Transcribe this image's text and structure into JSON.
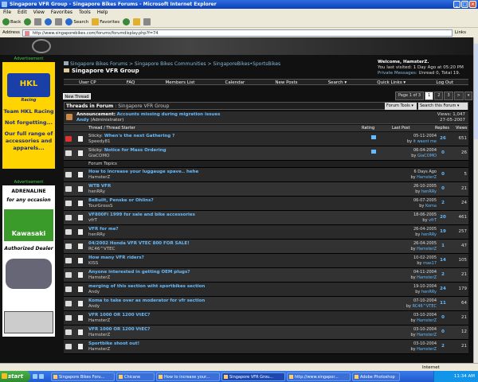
{
  "window": {
    "title": "Singapore VFR Group - Singapore Bikes Forums - Microsoft Internet Explorer"
  },
  "menu": [
    "File",
    "Edit",
    "View",
    "Favorites",
    "Tools",
    "Help"
  ],
  "toolbar": {
    "back": "Back",
    "search": "Search",
    "favorites": "Favorites"
  },
  "address": {
    "label": "Address",
    "url": "http://www.singaporebikes.com/forums/forumdisplay.php?f=74",
    "links": "Links"
  },
  "sidebar": {
    "ad_label_1": "Advertisement",
    "ad1_brand": "HKL",
    "ad1_sub": "Racing",
    "ad1_line1": "Team HKL Racing",
    "ad1_line2": "Not forgetting...",
    "ad1_line3": "Our full range of",
    "ad1_line4": "accessories and",
    "ad1_line5": "apparels...",
    "ad_label_2": "Advertisement",
    "ad2_line1": "ADRENALINE",
    "ad2_line2": "for any occasion",
    "ad2_brand": "Kawasaki",
    "ad2_line3": "Authorized Dealer"
  },
  "breadcrumb": "Singapore Bikes Forums > Singapore Bikes Communities > SingaporeBikes•SportsBikes",
  "page_title": "Singapore VFR Group",
  "welcome": {
    "greeting": "Welcome, HamsterZ.",
    "last_visit": "You last visited: 1 Day Ago at 05:20 PM",
    "pm_label": "Private Messages:",
    "pm_value": "Unread 0, Total 19."
  },
  "nav": [
    "User CP",
    "FAQ",
    "Members List",
    "Calendar",
    "New Posts",
    "Search ▾",
    "Quick Links ▾",
    "Log Out"
  ],
  "new_thread": "New Thread",
  "pager": [
    "Page 1 of 3",
    "1",
    "2",
    "3",
    ">",
    "▾"
  ],
  "thread_header": {
    "title": "Threads in Forum",
    "forum": ": Singapore VFR Group",
    "tools": "Forum Tools ▾",
    "search": "Search this Forum ▾"
  },
  "announcement": {
    "label": "Announcement:",
    "title": "Accounts missing during migration issues",
    "author": "Andy",
    "role": "(Administrator)",
    "views": "Views: 1,047",
    "date": "27-05-2007"
  },
  "columns": {
    "thread": "Thread / Thread Starter",
    "rating": "Rating",
    "last_post": "Last Post",
    "replies": "Replies",
    "views": "Views"
  },
  "sticky_threads": [
    {
      "prefix": "Sticky:",
      "title": "When's the next Gathering ?",
      "author": "Speedy81",
      "date": "05-11-2004",
      "by": "it wasnt me",
      "replies": "26",
      "views": "651"
    },
    {
      "prefix": "Sticky:",
      "title": "Notice for Mass Ordering",
      "author": "GiaCOMO",
      "date": "06-04-2004",
      "by": "GiaCOMO",
      "replies": "0",
      "views": "26"
    }
  ],
  "section_label": "Forum Topics",
  "threads": [
    {
      "title": "How to increase your luggauge spave.. hehe",
      "author": "HamsterZ",
      "date": "6 Days Ago",
      "by": "HamsterZ",
      "replies": "0",
      "views": "5"
    },
    {
      "title": "WTB VFR",
      "author": "henRRy",
      "date": "26-10-2005",
      "by": "henRRy",
      "replies": "0",
      "views": "21"
    },
    {
      "title": "BeBuilt, Penske or Ohlins?",
      "author": "TourGrossS",
      "date": "06-07-2005",
      "by": "Koma",
      "replies": "2",
      "views": "24"
    },
    {
      "title": "VF800Fi 1999 for sale and bike accessories",
      "author": "vfrT",
      "date": "18-06-2005",
      "by": "vfrT",
      "replies": "20",
      "views": "461"
    },
    {
      "title": "VFR for me?",
      "author": "henRRy",
      "date": "26-04-2005",
      "by": "henRRy",
      "replies": "19",
      "views": "257"
    },
    {
      "title": "04/2002 Honda VFR VTEC 800 FOR SALE!",
      "author": "RC46^VTEC",
      "date": "26-04-2005",
      "by": "HamsterZ",
      "replies": "1",
      "views": "47"
    },
    {
      "title": "How many VFR riders?",
      "author": "KISS",
      "date": "10-02-2005",
      "by": "mas17",
      "replies": "14",
      "views": "105"
    },
    {
      "title": "Anyone interested in getting OEM plugs?",
      "author": "HamsterZ",
      "date": "04-11-2004",
      "by": "HamsterZ",
      "replies": "2",
      "views": "21"
    },
    {
      "title": "merging of this section wiht sportbikes section",
      "author": "Andy",
      "date": "19-10-2004",
      "by": "henRRy",
      "replies": "24",
      "views": "179"
    },
    {
      "title": "Koma to take over as moderator for vfr section",
      "author": "Andy",
      "date": "07-10-2004",
      "by": "RC46^VTEC",
      "replies": "11",
      "views": "64"
    },
    {
      "title": "VFR 1000 OR 1200 VtEC?",
      "author": "HamsterZ",
      "date": "03-10-2004",
      "by": "HamsterZ",
      "replies": "0",
      "views": "21"
    },
    {
      "title": "VFR 1000 OR 1200 VtEC?",
      "author": "HamsterZ",
      "date": "03-10-2004",
      "by": "HamsterZ",
      "replies": "0",
      "views": "12"
    },
    {
      "title": "Sportbike shoot out!",
      "author": "HamsterZ",
      "date": "03-10-2004",
      "by": "HamsterZ",
      "replies": "2",
      "views": "21"
    }
  ],
  "statusbar": {
    "zone": "Internet"
  },
  "taskbar": {
    "start": "start",
    "tasks": [
      "Singapore Bikes Foru...",
      "Chicane",
      "How to increase your...",
      "Singapore VFR Grou...",
      "http://www.singapor...",
      "Adobe Photoshop"
    ],
    "clock": "11:34 AM"
  }
}
